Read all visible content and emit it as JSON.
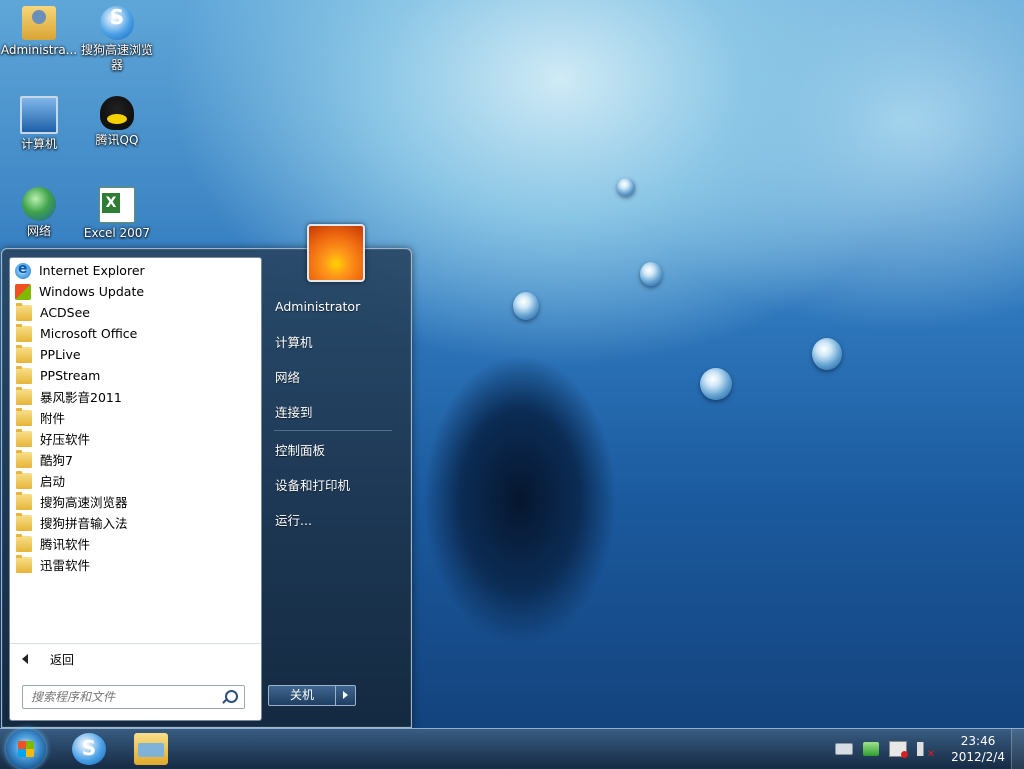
{
  "desktop": {
    "icons": [
      {
        "label": "Administra..."
      },
      {
        "label": "搜狗高速浏览器"
      },
      {
        "label": "计算机"
      },
      {
        "label": "腾讯QQ"
      },
      {
        "label": "网络"
      },
      {
        "label": "Excel 2007"
      }
    ]
  },
  "start_menu": {
    "programs": [
      {
        "label": "Internet Explorer",
        "icon": "internet-explorer-icon"
      },
      {
        "label": "Windows Update",
        "icon": "windows-update-icon"
      },
      {
        "label": "ACDSee",
        "icon": "folder-icon"
      },
      {
        "label": "Microsoft Office",
        "icon": "folder-icon"
      },
      {
        "label": "PPLive",
        "icon": "folder-icon"
      },
      {
        "label": "PPStream",
        "icon": "folder-icon"
      },
      {
        "label": "暴风影音2011",
        "icon": "folder-icon"
      },
      {
        "label": "附件",
        "icon": "folder-icon"
      },
      {
        "label": "好压软件",
        "icon": "folder-icon"
      },
      {
        "label": "酷狗7",
        "icon": "folder-icon"
      },
      {
        "label": "启动",
        "icon": "folder-icon"
      },
      {
        "label": "搜狗高速浏览器",
        "icon": "folder-icon"
      },
      {
        "label": "搜狗拼音输入法",
        "icon": "folder-icon"
      },
      {
        "label": "腾讯软件",
        "icon": "folder-icon"
      },
      {
        "label": "迅雷软件",
        "icon": "folder-icon"
      }
    ],
    "back_label": "返回",
    "search_placeholder": "搜索程序和文件",
    "right_items": [
      {
        "label": "Administrator"
      },
      {
        "label": "计算机"
      },
      {
        "label": "网络"
      },
      {
        "label": "连接到"
      },
      {
        "label": "控制面板"
      },
      {
        "label": "设备和打印机"
      },
      {
        "label": "运行..."
      }
    ],
    "shutdown_label": "关机"
  },
  "taskbar": {
    "time": "23:46",
    "date": "2012/2/4"
  },
  "colors": {
    "accent": "#1b5a9e",
    "menu_bg": "#1f3e62"
  }
}
